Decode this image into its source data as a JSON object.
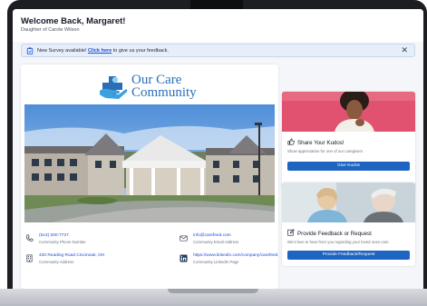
{
  "header": {
    "welcome": "Welcome Back, Margaret!",
    "subtitle": "Daughter of Carole Wilson"
  },
  "banner": {
    "text_before": "New Survey available!",
    "link": "Click here",
    "text_after": "to give us your feedback.",
    "close": "✕"
  },
  "logo": {
    "line1": "Our Care",
    "line2": "Community"
  },
  "contacts": {
    "phone": {
      "value": "(513) 000-7727",
      "label": "Community Phone Number"
    },
    "email": {
      "value": "info@carefeed.com",
      "label": "Community Email Address"
    },
    "address": {
      "value": "430 Reading Road Cincinnati, OH",
      "label": "Community Address"
    },
    "linkedin": {
      "value": "https://www.linkedin.com/company/carefeed",
      "label": "Community LinkedIn Page"
    }
  },
  "kudos": {
    "title": "Share Your Kudos!",
    "description": "Show appreciation for one of our caregivers",
    "button": "Give Kudos"
  },
  "feedback": {
    "title": "Provide Feedback or Request",
    "description": "We'd love to hear from you regarding your loved ones care.",
    "button": "Provide Feedback/Request"
  },
  "colors": {
    "primary": "#1d65c1",
    "link": "#1d4ed8",
    "logo": "#2a6fb6",
    "banner_bg": "#e6eef9",
    "kudos_bg": "#e0526f"
  }
}
